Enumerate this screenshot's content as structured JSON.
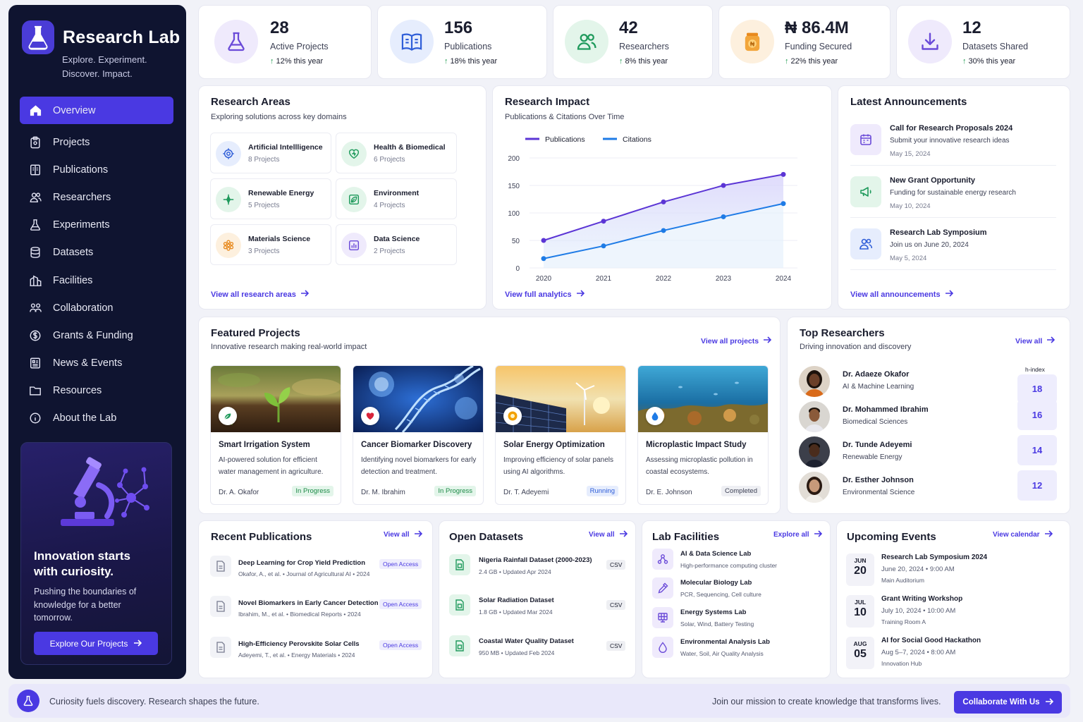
{
  "brand": {
    "title": "Research Lab",
    "tagline_line1": "Explore. Experiment.",
    "tagline_line2": "Discover. Impact."
  },
  "nav": [
    {
      "label": "Overview",
      "icon": "home-icon"
    },
    {
      "label": "Projects",
      "icon": "clipboard-icon"
    },
    {
      "label": "Publications",
      "icon": "book-icon"
    },
    {
      "label": "Researchers",
      "icon": "users-icon"
    },
    {
      "label": "Experiments",
      "icon": "flask-icon"
    },
    {
      "label": "Datasets",
      "icon": "database-icon"
    },
    {
      "label": "Facilities",
      "icon": "building-icon"
    },
    {
      "label": "Collaboration",
      "icon": "collaboration-icon"
    },
    {
      "label": "Grants & Funding",
      "icon": "money-icon"
    },
    {
      "label": "News & Events",
      "icon": "newspaper-icon"
    },
    {
      "label": "Resources",
      "icon": "folder-icon"
    },
    {
      "label": "About the Lab",
      "icon": "info-icon"
    }
  ],
  "promo": {
    "title_line1": "Innovation starts",
    "title_line2": "with curiosity.",
    "text": "Pushing the boundaries of knowledge for a better tomorrow.",
    "button": "Explore Our Projects"
  },
  "stats": [
    {
      "value": "28",
      "label": "Active Projects",
      "delta": "12% this year",
      "icon": "flask-icon",
      "color": "#6a4ad8"
    },
    {
      "value": "156",
      "label": "Publications",
      "delta": "18% this year",
      "icon": "book-icon",
      "color": "#2f5ed8"
    },
    {
      "value": "42",
      "label": "Researchers",
      "delta": "8% this year",
      "icon": "users-icon",
      "color": "#1f9a5c"
    },
    {
      "value": "₦ 86.4M",
      "label": "Funding Secured",
      "delta": "22% this year",
      "icon": "money-jar-icon",
      "color": "#e88a1e"
    },
    {
      "value": "12",
      "label": "Datasets Shared",
      "delta": "30% this year",
      "icon": "download-icon",
      "color": "#6a4ad8"
    }
  ],
  "research_areas": {
    "title": "Research Areas",
    "subtitle": "Exploring solutions across key domains",
    "link": "View all research areas",
    "items": [
      {
        "name": "Artificial Intellligence",
        "count": "8 Projects",
        "icon": "ai-chip-icon",
        "color": "#2f5ed8",
        "bg": "#e6edfd"
      },
      {
        "name": "Health & Biomedical",
        "count": "6 Projects",
        "icon": "heart-icon",
        "color": "#1f9a5c",
        "bg": "#e3f5ea"
      },
      {
        "name": "Renewable Energy",
        "count": "5 Projects",
        "icon": "energy-icon",
        "color": "#1f9a5c",
        "bg": "#e3f5ea"
      },
      {
        "name": "Environment",
        "count": "4 Projects",
        "icon": "leaf-icon",
        "color": "#1f9a5c",
        "bg": "#e3f5ea"
      },
      {
        "name": "Materials Science",
        "count": "3 Projects",
        "icon": "atom-icon",
        "color": "#e88a1e",
        "bg": "#fdf0de"
      },
      {
        "name": "Data Science",
        "count": "2 Projects",
        "icon": "chart-icon",
        "color": "#6a4ad8",
        "bg": "#efeafc"
      }
    ]
  },
  "impact": {
    "title": "Research Impact",
    "subtitle": "Publications & Citations Over Time",
    "link": "View full analytics"
  },
  "chart_data": {
    "type": "line",
    "x": [
      "2020",
      "2021",
      "2022",
      "2023",
      "2024"
    ],
    "series": [
      {
        "name": "Publications",
        "values": [
          50,
          85,
          120,
          150,
          170
        ],
        "color": "#5b35d5"
      },
      {
        "name": "Citations",
        "values": [
          17,
          40,
          68,
          93,
          117
        ],
        "color": "#1e7be6"
      }
    ],
    "yticks": [
      "0",
      "50",
      "100",
      "150",
      "200"
    ],
    "ylim": [
      0,
      200
    ],
    "grid": true,
    "legend": "top-left"
  },
  "announcements": {
    "title": "Latest Announcements",
    "link": "View all announcements",
    "items": [
      {
        "title": "Call for Research Proposals 2024",
        "desc": "Submit your innovative research ideas",
        "date": "May 15, 2024",
        "icon": "calendar-icon",
        "color": "#6a4ad8",
        "bg": "#efeafc"
      },
      {
        "title": "New Grant Opportunity",
        "desc": "Funding for sustainable energy research",
        "date": "May 10, 2024",
        "icon": "megaphone-icon",
        "color": "#1f9a5c",
        "bg": "#e3f5ea"
      },
      {
        "title": "Research Lab Symposium",
        "desc": "Join us on June 20, 2024",
        "date": "May 5, 2024",
        "icon": "users-icon",
        "color": "#2f5ed8",
        "bg": "#e6edfd"
      }
    ]
  },
  "featured": {
    "title": "Featured Projects",
    "subtitle": "Innovative research making real-world impact",
    "link": "View all projects",
    "items": [
      {
        "title": "Smart Irrigation System",
        "desc": "AI-powered solution for efficient water management in agriculture.",
        "author": "Dr. A. Okafor",
        "status": "In Progress",
        "status_color": "#1d8a47",
        "status_bg": "#e3f5ea",
        "badge_icon": "leaf-icon",
        "badge_color": "#1f9a5c"
      },
      {
        "title": "Cancer Biomarker Discovery",
        "desc": "Identifying novel biomarkers for early detection and treatment.",
        "author": "Dr. M. Ibrahim",
        "status": "In Progress",
        "status_color": "#1d8a47",
        "status_bg": "#e3f5ea",
        "badge_icon": "heart-icon",
        "badge_color": "#d8243a"
      },
      {
        "title": "Solar Energy Optimization",
        "desc": "Improving efficiency of solar panels using AI algorithms.",
        "author": "Dr. T. Adeyemi",
        "status": "Running",
        "status_color": "#2f5ed8",
        "status_bg": "#e6edfd",
        "badge_icon": "sun-icon",
        "badge_color": "#f2a000"
      },
      {
        "title": "Microplastic Impact Study",
        "desc": "Assessing microplastic pollution in coastal ecosystems.",
        "author": "Dr. E. Johnson",
        "status": "Completed",
        "status_color": "#3d4155",
        "status_bg": "#eeeff3",
        "badge_icon": "water-drop-icon",
        "badge_color": "#1e7be6"
      }
    ]
  },
  "researchers": {
    "title": "Top Researchers",
    "subtitle": "Driving innovation and discovery",
    "link": "View all",
    "hindex_label": "h-index",
    "items": [
      {
        "name": "Dr. Adaeze Okafor",
        "field": "AI & Machine Learning",
        "hindex": "18"
      },
      {
        "name": "Dr. Mohammed Ibrahim",
        "field": "Biomedical Sciences",
        "hindex": "16"
      },
      {
        "name": "Dr. Tunde Adeyemi",
        "field": "Renewable Energy",
        "hindex": "14"
      },
      {
        "name": "Dr. Esther Johnson",
        "field": "Environmental Science",
        "hindex": "12"
      }
    ]
  },
  "publications": {
    "title": "Recent Publications",
    "link": "View all",
    "items": [
      {
        "title": "Deep Learning for Crop Yield Prediction",
        "meta": "Okafor, A., et al. • Journal of Agricultural AI • 2024",
        "tag": "Open Access"
      },
      {
        "title": "Novel Biomarkers in Early Cancer Detection",
        "meta": "Ibrahim, M., et al. • Biomedical Reports • 2024",
        "tag": "Open Access"
      },
      {
        "title": "High-Efficiency Perovskite Solar Cells",
        "meta": "Adeyemi, T., et al. • Energy Materials • 2024",
        "tag": "Open Access"
      }
    ]
  },
  "datasets": {
    "title": "Open Datasets",
    "link": "View all",
    "items": [
      {
        "title": "Nigeria Rainfall Dataset (2000-2023)",
        "meta": "2.4 GB • Updated Apr 2024",
        "tag": "CSV"
      },
      {
        "title": "Solar Radiation Dataset",
        "meta": "1.8 GB • Updated Mar 2024",
        "tag": "CSV"
      },
      {
        "title": "Coastal Water Quality Dataset",
        "meta": "950 MB • Updated Feb 2024",
        "tag": "CSV"
      }
    ]
  },
  "facilities": {
    "title": "Lab Facilities",
    "link": "Explore all",
    "items": [
      {
        "title": "AI & Data Science Lab",
        "desc": "High-performance computing cluster",
        "icon": "network-icon"
      },
      {
        "title": "Molecular Biology Lab",
        "desc": "PCR, Sequencing, Cell culture",
        "icon": "pipette-icon"
      },
      {
        "title": "Energy Systems Lab",
        "desc": "Solar, Wind, Battery Testing",
        "icon": "solar-panel-icon"
      },
      {
        "title": "Environmental Analysis Lab",
        "desc": "Water, Soil, Air Quality Analysis",
        "icon": "water-drop-icon"
      }
    ]
  },
  "events": {
    "title": "Upcoming Events",
    "link": "View calendar",
    "items": [
      {
        "month": "JUN",
        "day": "20",
        "title": "Research Lab Symposium 2024",
        "when": "June 20, 2024 • 9:00 AM",
        "where": "Main Auditorium"
      },
      {
        "month": "JUL",
        "day": "10",
        "title": "Grant Writing Workshop",
        "when": "July 10, 2024 • 10:00 AM",
        "where": "Training Room A"
      },
      {
        "month": "AUG",
        "day": "05",
        "title": "AI for Social Good Hackathon",
        "when": "Aug 5–7, 2024 • 8:00 AM",
        "where": "Innovation Hub"
      }
    ]
  },
  "footer": {
    "left": "Curiosity fuels discovery. Research shapes the future.",
    "right": "Join our mission to create knowledge that transforms lives.",
    "button": "Collaborate With Us"
  }
}
